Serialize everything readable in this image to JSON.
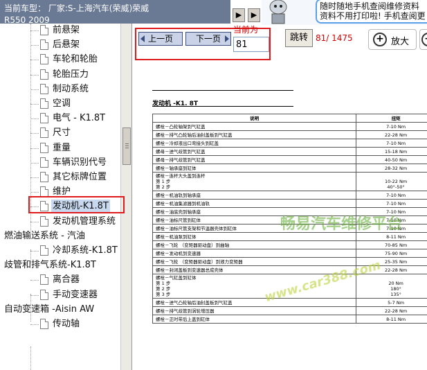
{
  "titlebar": {
    "line1": "当前车型： 厂家:S-上海汽车(荣威)荣威",
    "line2": "R550 2009"
  },
  "nav_arrows": {
    "left": "◀",
    "right": "▶"
  },
  "ad": {
    "line1": "随时随地手机查阅维修资料",
    "line2": "资料不用打印啦! 手机查阅更"
  },
  "toolbar": {
    "prev_label": "上一页",
    "next_label": "下一页",
    "current_page_label": "当前为",
    "current_page_value": "81",
    "jump_label": "跳转",
    "page_count": "81/ 1475",
    "zoom_in_label": "放大",
    "zoom_in_glyph": "+",
    "zoom_out_glyph": "−"
  },
  "tree": {
    "nodes": [
      {
        "label": "前悬架",
        "level": 2
      },
      {
        "label": "后悬架",
        "level": 2
      },
      {
        "label": "车轮和轮胎",
        "level": 2
      },
      {
        "label": "轮胎压力",
        "level": 2
      },
      {
        "label": "制动系统",
        "level": 2
      },
      {
        "label": "空调",
        "level": 2
      },
      {
        "label": "电气 - K1.8T",
        "level": 2
      },
      {
        "label": "尺寸",
        "level": 2
      },
      {
        "label": "重量",
        "level": 2
      },
      {
        "label": "车辆识别代号",
        "level": 2
      },
      {
        "label": "其它标牌位置",
        "level": 2
      },
      {
        "label": "维护",
        "level": 2
      },
      {
        "label": "发动机-K1.8T",
        "level": 2,
        "selected": true
      },
      {
        "label": "发动机管理系统",
        "level": 2
      },
      {
        "label": "燃油输送系统 - 汽油",
        "level": 1
      },
      {
        "label": "冷却系统-K1.8T",
        "level": 2
      },
      {
        "label": "歧管和排气系统-K1.8T",
        "level": 1
      },
      {
        "label": "离合器",
        "level": 2
      },
      {
        "label": "手动变速器",
        "level": 2
      },
      {
        "label": "自动变速箱 -Aisin AW",
        "level": 1
      },
      {
        "label": "传动轴",
        "level": 2
      }
    ]
  },
  "document": {
    "title": "发动机 -K1. 8T",
    "table_headers": {
      "desc": "说明",
      "torque": "扭矩"
    },
    "rows": [
      {
        "desc": "螺栓－凸轮轴架到气缸盖",
        "val": "7-10 Nm"
      },
      {
        "desc": "螺栓－排气凸轮轴后油封盖板到气缸盖",
        "val": "22-28 Nm"
      },
      {
        "desc": "螺栓－冷却液出口弯接头到缸盖",
        "val": "7-10 Nm"
      },
      {
        "desc": "螺母－进气歧管到气缸盖",
        "val": "15-18 Nm"
      },
      {
        "desc": "螺母－排气歧管到气缸盖",
        "val": "40-50 Nm"
      },
      {
        "desc": "螺栓－轴承座到缸体",
        "val": "28-32 Nm"
      },
      {
        "desc": "螺栓－连杆大头盖到连杆\n第 1 步\n第 2 步",
        "val": "\n10-22 Nm\n40°-50°"
      },
      {
        "desc": "螺栓－机油轨到轴承座",
        "val": "7-10 Nm"
      },
      {
        "desc": "螺栓－机油集滤器到机油轨",
        "val": "7-10 Nm"
      },
      {
        "desc": "螺栓－油底壳到轴承座",
        "val": "7-10 Nm"
      },
      {
        "desc": "螺栓－油标尺管到缸体",
        "val": "7-10 Nm"
      },
      {
        "desc": "螺栓－油标尺管支架和节温器壳体到缸体",
        "val": "7-10 Nm"
      },
      {
        "desc": "螺栓－机油泵到缸体",
        "val": "8-11 Nm"
      },
      {
        "desc": "螺栓－飞轮 （变矩器驱动盘）到曲轴",
        "val": "70-85 Nm"
      },
      {
        "desc": "螺栓－发动机到变速器",
        "val": "75-90 Nm"
      },
      {
        "desc": "螺栓－飞轮 （变矩器驱动盘）到液力变矩器",
        "val": "25-35 Nm"
      },
      {
        "desc": "螺栓－封闭盖板到变速器总成壳体",
        "val": "22-28 Nm"
      },
      {
        "desc": "螺栓－气缸盖到缸体\n第 1 步\n第 2 步\n第 3 步",
        "val": "\n20 Nm\n180°\n135°"
      },
      {
        "desc": "螺栓－进气凸轮轴后油封盖板到气缸盖",
        "val": "5-7 Nm"
      },
      {
        "desc": "螺栓－排气歧管到涡轮增压器",
        "val": "22-28 Nm"
      },
      {
        "desc": "螺栓－正时带后上盖到缸体",
        "val": "8-11 Nm"
      }
    ]
  },
  "watermarks": {
    "text1": "畅易汽车维修平台",
    "text2": "www.car388.com"
  }
}
